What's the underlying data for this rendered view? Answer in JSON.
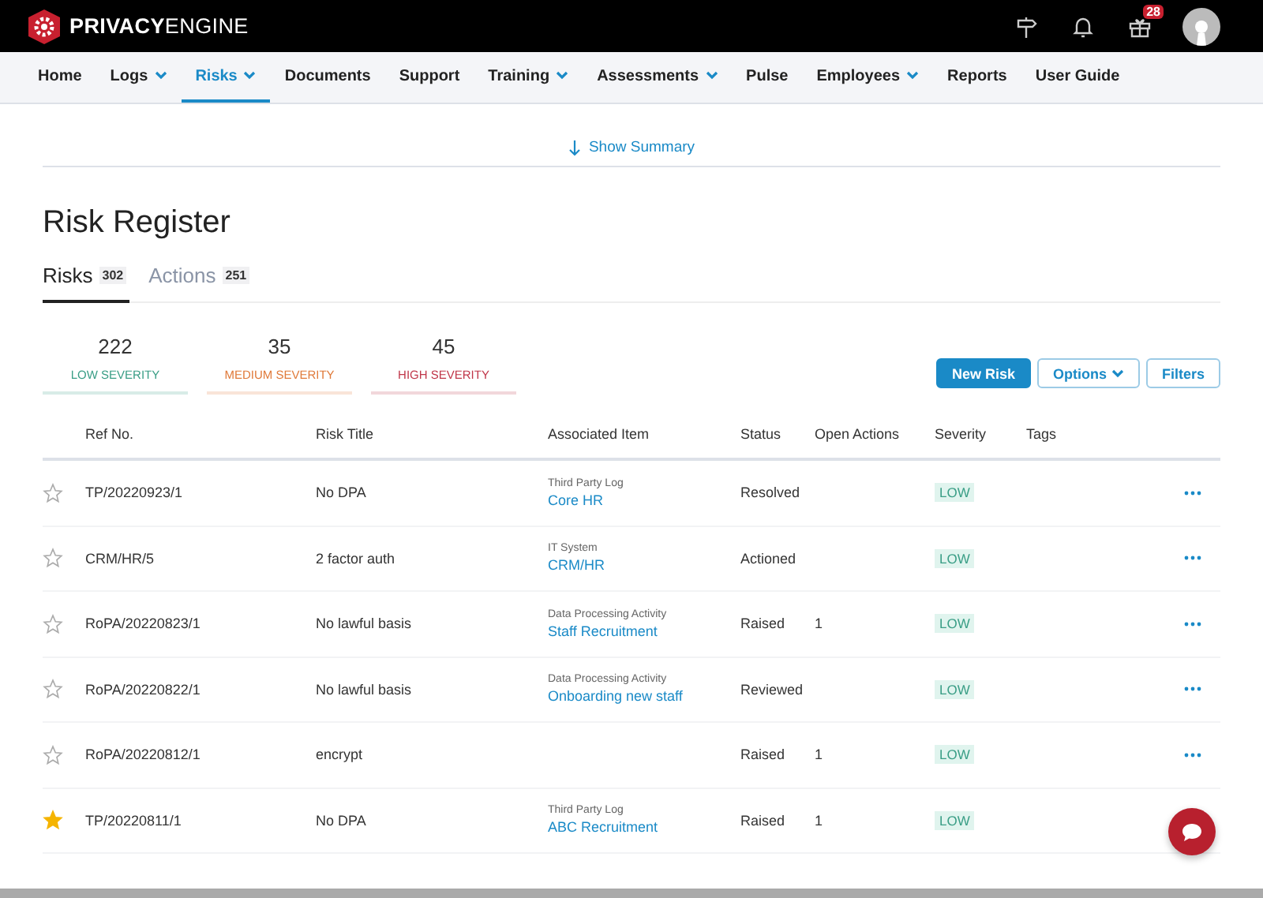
{
  "header": {
    "logo": "**PRIVACY**ENGINE",
    "gift_badge": "28"
  },
  "nav": [
    {
      "label": "Home",
      "dropdown": false,
      "selected": false
    },
    {
      "label": "Logs",
      "dropdown": true,
      "selected": false
    },
    {
      "label": "Risks",
      "dropdown": true,
      "selected": true
    },
    {
      "label": "Documents",
      "dropdown": false,
      "selected": false
    },
    {
      "label": "Support",
      "dropdown": false,
      "selected": false
    },
    {
      "label": "Training",
      "dropdown": true,
      "selected": false
    },
    {
      "label": "Assessments",
      "dropdown": true,
      "selected": false
    },
    {
      "label": "Pulse",
      "dropdown": false,
      "selected": false
    },
    {
      "label": "Employees",
      "dropdown": true,
      "selected": false
    },
    {
      "label": "Reports",
      "dropdown": false,
      "selected": false
    },
    {
      "label": "User Guide",
      "dropdown": false,
      "selected": false
    }
  ],
  "summary_toggle": "Show Summary",
  "title": "Risk Register",
  "tabs": [
    {
      "label": "Risks",
      "count": "302",
      "selected": true
    },
    {
      "label": "Actions",
      "count": "251",
      "selected": false
    }
  ],
  "severity_stats": [
    {
      "count": "222",
      "label": "LOW SEVERITY",
      "color": "#3a9e86"
    },
    {
      "count": "35",
      "label": "MEDIUM SEVERITY",
      "color": "#e07a3a"
    },
    {
      "count": "45",
      "label": "HIGH SEVERITY",
      "color": "#c0374a"
    }
  ],
  "buttons": [
    {
      "label": "New Risk",
      "kind": "primary",
      "dropdown": false
    },
    {
      "label": "Options",
      "kind": "outline",
      "dropdown": true
    },
    {
      "label": "Filters",
      "kind": "outline",
      "dropdown": false
    }
  ],
  "table": {
    "columns": [
      "Ref No.",
      "Risk Title",
      "Associated Item",
      "Status",
      "Open Actions",
      "Severity",
      "Tags"
    ],
    "rows": [
      {
        "starred": false,
        "ref": "TP/20220923/1",
        "title": "No DPA",
        "item_type": "Third Party Log",
        "item": "Core HR",
        "status": "Resolved",
        "open_actions": "",
        "severity": "LOW"
      },
      {
        "starred": false,
        "ref": "CRM/HR/5",
        "title": "2 factor auth",
        "item_type": "IT System",
        "item": "CRM/HR",
        "status": "Actioned",
        "open_actions": "",
        "severity": "LOW"
      },
      {
        "starred": false,
        "ref": "RoPA/20220823/1",
        "title": "No lawful basis",
        "item_type": "Data Processing Activity",
        "item": "Staff Recruitment",
        "status": "Raised",
        "open_actions": "1",
        "severity": "LOW"
      },
      {
        "starred": false,
        "ref": "RoPA/20220822/1",
        "title": "No lawful basis",
        "item_type": "Data Processing Activity",
        "item": "Onboarding new staff",
        "status": "Reviewed",
        "open_actions": "",
        "severity": "LOW"
      },
      {
        "starred": false,
        "ref": "RoPA/20220812/1",
        "title": "encrypt",
        "item_type": "",
        "item": "",
        "status": "Raised",
        "open_actions": "1",
        "severity": "LOW"
      },
      {
        "starred": true,
        "ref": "TP/20220811/1",
        "title": "No DPA",
        "item_type": "Third Party Log",
        "item": "ABC Recruitment",
        "status": "Raised",
        "open_actions": "1",
        "severity": "LOW"
      }
    ]
  }
}
